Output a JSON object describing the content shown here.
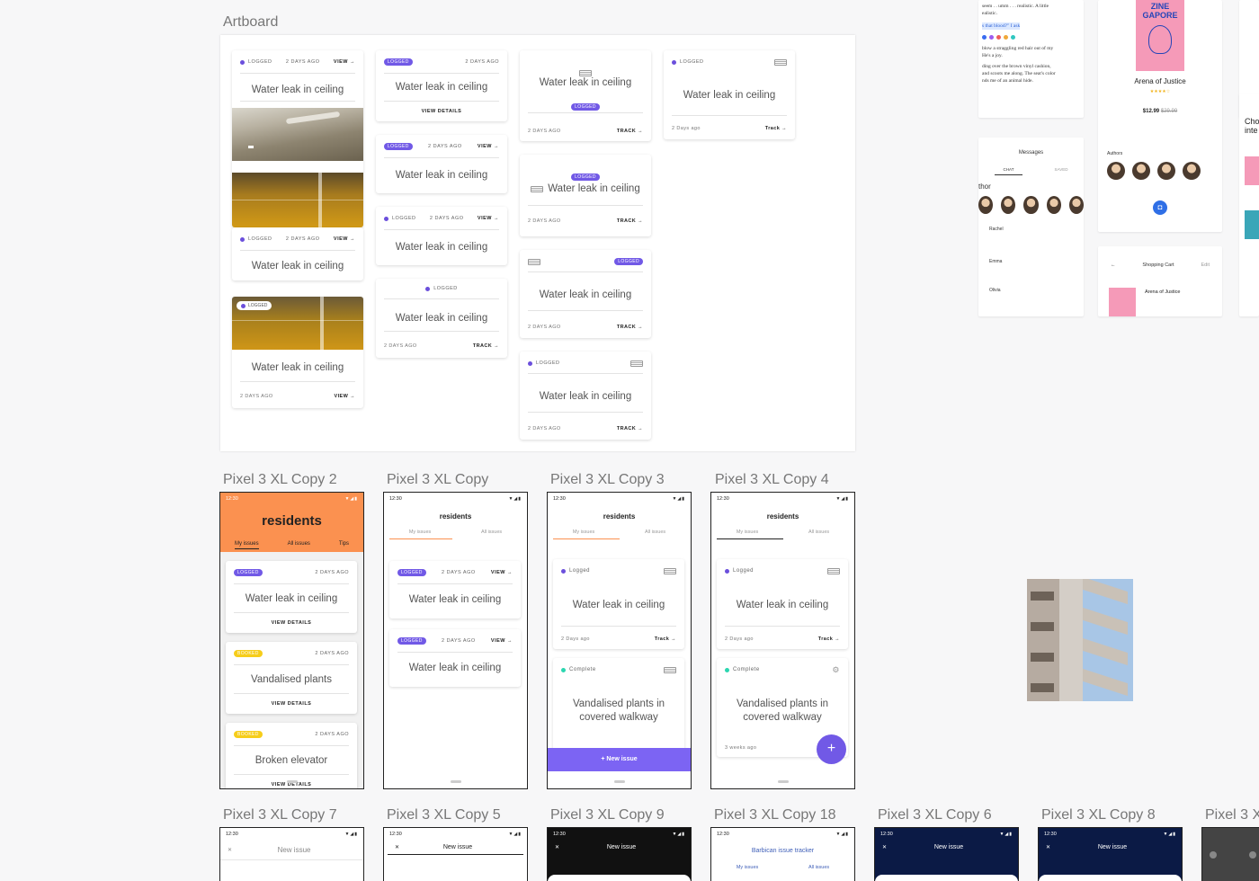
{
  "labels": {
    "artboard": "Artboard",
    "p1": "Pixel 3 XL Copy 2",
    "p2": "Pixel 3 XL Copy",
    "p3": "Pixel 3 XL Copy 3",
    "p4": "Pixel 3 XL Copy 4",
    "b1": "Pixel 3 XL Copy 7",
    "b2": "Pixel 3 XL Copy 5",
    "b3": "Pixel 3 XL Copy 9",
    "b4": "Pixel 3 XL Copy 18",
    "b5": "Pixel 3 XL Copy 6",
    "b6": "Pixel 3 XL Copy 8",
    "b7": "Pixel 3 X"
  },
  "card": {
    "logged": "LOGGED",
    "logged_title": "Logged",
    "booked": "BOOKED",
    "complete": "Complete",
    "days_ago": "2 DAYS AGO",
    "days_ago_title": "2 Days ago",
    "weeks_ago": "3 weeks ago",
    "view": "VIEW →",
    "view_details": "VIEW DETAILS",
    "track": "TRACK →",
    "track_title": "Track →",
    "title": "Water leak in ceiling",
    "vandalised": "Vandalised plants",
    "vandalised_walkway_1": "Vandalised plants in",
    "vandalised_walkway_2": "covered walkway",
    "elevator": "Broken elevator"
  },
  "phone": {
    "time": "12:30",
    "signal": "▼◢▮",
    "app_title": "residents",
    "tab_my": "My issues",
    "tab_all": "All issues",
    "tab_tips": "Tips",
    "new_issue": "+ New issue",
    "new_issue_title": "New issue",
    "close": "✕",
    "barbican": "Barbican issue tracker",
    "fab": "+"
  },
  "right": {
    "book_line1": "seem . . umm . . . realistic. A little",
    "book_line2": "ealistic.",
    "book_quote": "s that blood?\" I ask",
    "book_p1": "blow a straggling red hair out of my",
    "book_p2": "He's a joy.",
    "book_p3": "ding over the brown vinyl cashion,",
    "book_p4": "and scoots me along. The seat's color",
    "book_p5": "nds me of an animal hide.",
    "zine_1": "ZINE",
    "zine_2": "GAPORE",
    "book_title": "Arena of Justice",
    "stars": "★★★★☆",
    "price": "$12.99",
    "old_price": "$29.99",
    "authors": "Authors",
    "messages": "Messages",
    "chat": "CHAT",
    "saved": "SAVED",
    "author_frag": "thor",
    "rachel": "Rachel",
    "emma": "Emma",
    "olivia": "Olivia",
    "shopping_cart": "Shopping Cart",
    "edit": "Edit",
    "cho": "Cho",
    "inte": "inte"
  }
}
